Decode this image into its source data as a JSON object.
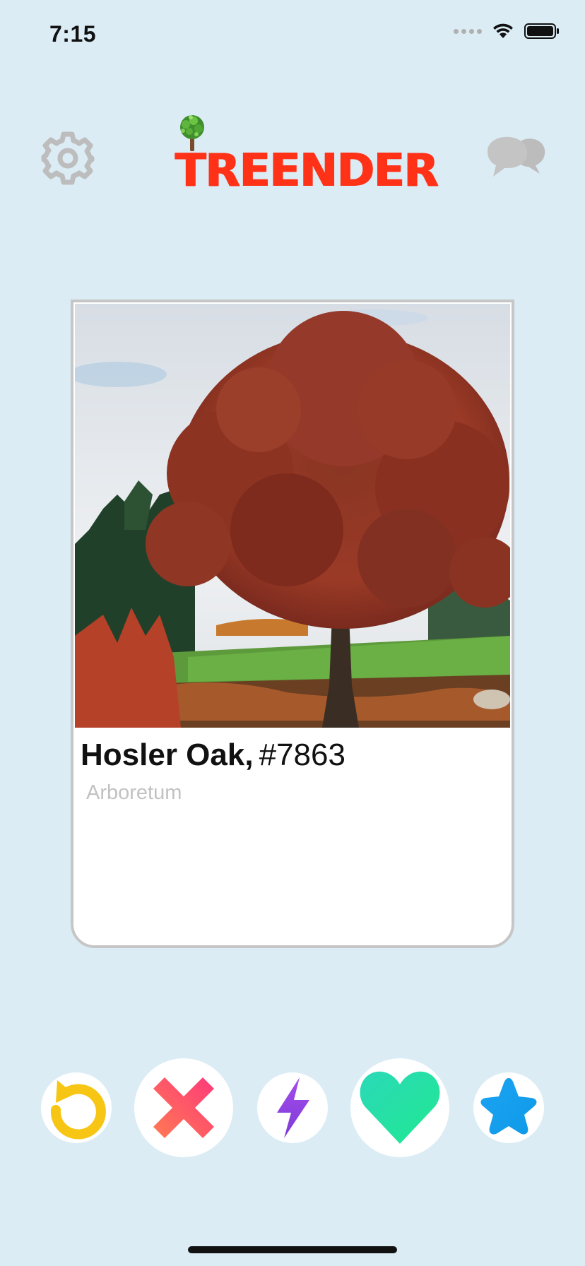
{
  "status_bar": {
    "time": "7:15"
  },
  "header": {
    "logo_text": "TREENDER",
    "settings_icon": "gear-icon",
    "chat_icon": "chat-bubbles-icon",
    "logo_icon": "tree-icon",
    "logo_color": "#ff3218"
  },
  "card": {
    "name": "Hosler Oak,",
    "number": "#7863",
    "location": "Arboretum",
    "photo_icon": "tree-photo"
  },
  "actions": [
    {
      "icon": "rewind-icon",
      "color": "#f7c513"
    },
    {
      "icon": "nope-x-icon",
      "color": "#fd4e6e"
    },
    {
      "icon": "boost-lightning-icon",
      "color": "#9a4ae2"
    },
    {
      "icon": "like-heart-icon",
      "color": "#2ee0a6"
    },
    {
      "icon": "super-like-star-icon",
      "color": "#15a8f0"
    }
  ],
  "colors": {
    "background": "#dbecf5",
    "card_border": "#c6c6c6",
    "location_text": "#c2c2c2"
  }
}
